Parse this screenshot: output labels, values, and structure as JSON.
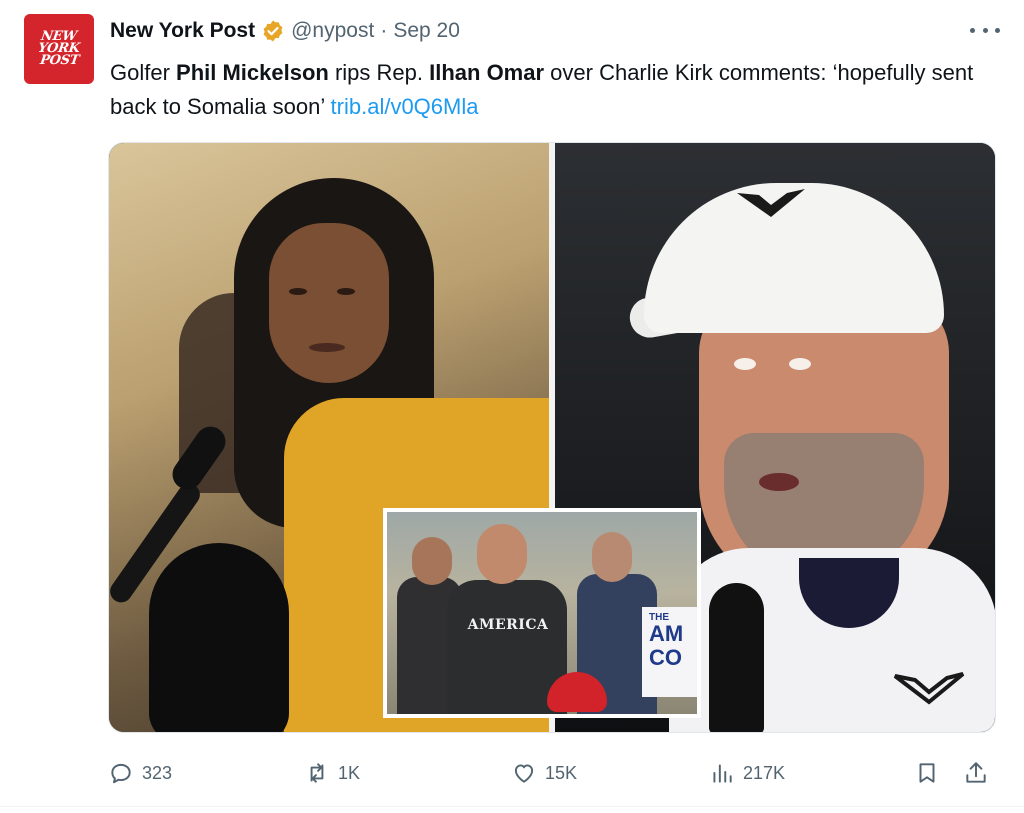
{
  "account": {
    "avatar_text": [
      "NEW",
      "YORK",
      "POST"
    ],
    "display_name": "New York Post",
    "verified": true,
    "verified_color": "#e8a628",
    "handle": "@nypost",
    "separator": "·",
    "date": "Sep 20"
  },
  "tweet": {
    "parts": [
      {
        "text": "Golfer ",
        "bold": false
      },
      {
        "text": "Phil Mickelson",
        "bold": true
      },
      {
        "text": " rips Rep. ",
        "bold": false
      },
      {
        "text": "Ilhan Omar",
        "bold": true
      },
      {
        "text": " over Charlie Kirk comments: ‘hopefully sent back to Somalia soon’ ",
        "bold": false
      }
    ],
    "link": "trib.al/v0Q6Mla",
    "link_color": "#1d9bf0"
  },
  "media": {
    "photos": [
      "woman-hijab-microphone",
      "golfer-white-cap",
      "inset-crowd-america-shirt"
    ],
    "inset_shirt_text": "AMERICA",
    "inset_sign_top": "THE",
    "inset_sign_text": [
      "AM",
      "CO"
    ]
  },
  "actions": {
    "reply": {
      "icon": "reply-icon",
      "count": "323"
    },
    "repost": {
      "icon": "repost-icon",
      "count": "1K"
    },
    "like": {
      "icon": "heart-icon",
      "count": "15K"
    },
    "views": {
      "icon": "views-icon",
      "count": "217K"
    },
    "bookmark": {
      "icon": "bookmark-icon"
    },
    "share": {
      "icon": "share-icon"
    }
  },
  "colors": {
    "text": "#0f1419",
    "muted": "#536471",
    "brand_red": "#d4252d"
  }
}
